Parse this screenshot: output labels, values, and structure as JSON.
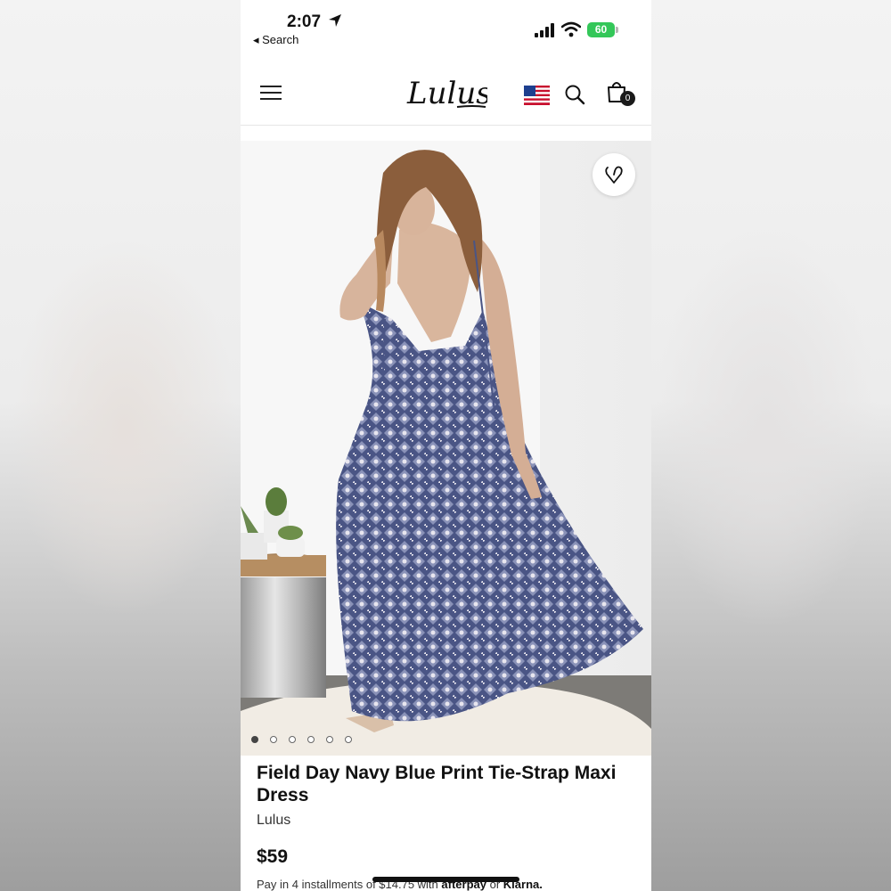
{
  "status_bar": {
    "time": "2:07",
    "back_label": "◂ Search",
    "battery": "60"
  },
  "header": {
    "logo_text": "Lulus",
    "cart_count": "0"
  },
  "carousel": {
    "slide_count": 6,
    "active_index": 0
  },
  "product": {
    "title": "Field Day Navy Blue Print Tie-Strap Maxi Dress",
    "brand": "Lulus",
    "price": "$59",
    "installment_text": "Pay in 4 installments of $14.75 with",
    "afterpay_label": "afterpay",
    "or_label": "or",
    "klarna_label": "Klarna."
  },
  "colors": {
    "battery_green": "#34c759",
    "text_dark": "#111111",
    "dress_navy": "#4a5585"
  }
}
